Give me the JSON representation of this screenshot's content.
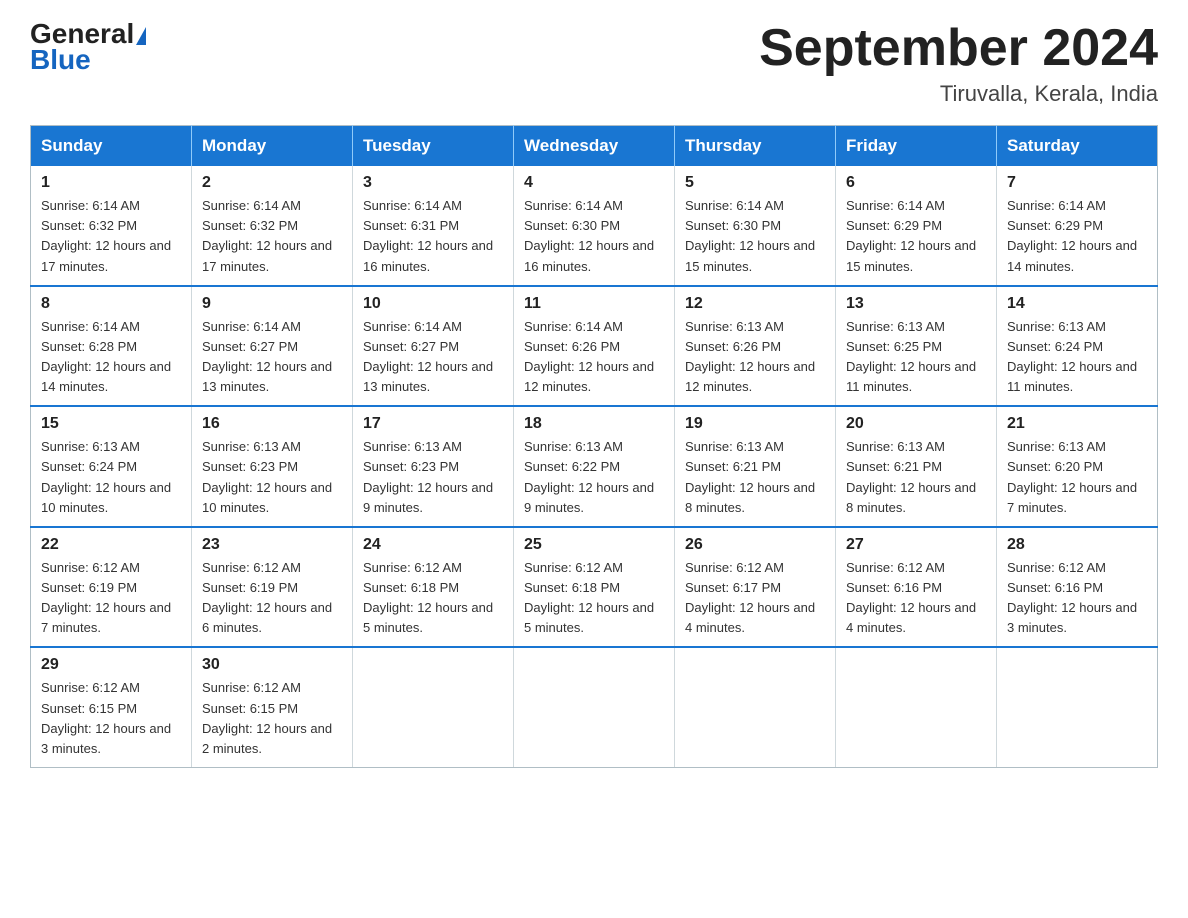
{
  "header": {
    "logo_general": "General",
    "logo_blue": "Blue",
    "title": "September 2024",
    "subtitle": "Tiruvalla, Kerala, India"
  },
  "weekdays": [
    "Sunday",
    "Monday",
    "Tuesday",
    "Wednesday",
    "Thursday",
    "Friday",
    "Saturday"
  ],
  "weeks": [
    [
      {
        "day": "1",
        "sunrise": "6:14 AM",
        "sunset": "6:32 PM",
        "daylight": "12 hours and 17 minutes."
      },
      {
        "day": "2",
        "sunrise": "6:14 AM",
        "sunset": "6:32 PM",
        "daylight": "12 hours and 17 minutes."
      },
      {
        "day": "3",
        "sunrise": "6:14 AM",
        "sunset": "6:31 PM",
        "daylight": "12 hours and 16 minutes."
      },
      {
        "day": "4",
        "sunrise": "6:14 AM",
        "sunset": "6:30 PM",
        "daylight": "12 hours and 16 minutes."
      },
      {
        "day": "5",
        "sunrise": "6:14 AM",
        "sunset": "6:30 PM",
        "daylight": "12 hours and 15 minutes."
      },
      {
        "day": "6",
        "sunrise": "6:14 AM",
        "sunset": "6:29 PM",
        "daylight": "12 hours and 15 minutes."
      },
      {
        "day": "7",
        "sunrise": "6:14 AM",
        "sunset": "6:29 PM",
        "daylight": "12 hours and 14 minutes."
      }
    ],
    [
      {
        "day": "8",
        "sunrise": "6:14 AM",
        "sunset": "6:28 PM",
        "daylight": "12 hours and 14 minutes."
      },
      {
        "day": "9",
        "sunrise": "6:14 AM",
        "sunset": "6:27 PM",
        "daylight": "12 hours and 13 minutes."
      },
      {
        "day": "10",
        "sunrise": "6:14 AM",
        "sunset": "6:27 PM",
        "daylight": "12 hours and 13 minutes."
      },
      {
        "day": "11",
        "sunrise": "6:14 AM",
        "sunset": "6:26 PM",
        "daylight": "12 hours and 12 minutes."
      },
      {
        "day": "12",
        "sunrise": "6:13 AM",
        "sunset": "6:26 PM",
        "daylight": "12 hours and 12 minutes."
      },
      {
        "day": "13",
        "sunrise": "6:13 AM",
        "sunset": "6:25 PM",
        "daylight": "12 hours and 11 minutes."
      },
      {
        "day": "14",
        "sunrise": "6:13 AM",
        "sunset": "6:24 PM",
        "daylight": "12 hours and 11 minutes."
      }
    ],
    [
      {
        "day": "15",
        "sunrise": "6:13 AM",
        "sunset": "6:24 PM",
        "daylight": "12 hours and 10 minutes."
      },
      {
        "day": "16",
        "sunrise": "6:13 AM",
        "sunset": "6:23 PM",
        "daylight": "12 hours and 10 minutes."
      },
      {
        "day": "17",
        "sunrise": "6:13 AM",
        "sunset": "6:23 PM",
        "daylight": "12 hours and 9 minutes."
      },
      {
        "day": "18",
        "sunrise": "6:13 AM",
        "sunset": "6:22 PM",
        "daylight": "12 hours and 9 minutes."
      },
      {
        "day": "19",
        "sunrise": "6:13 AM",
        "sunset": "6:21 PM",
        "daylight": "12 hours and 8 minutes."
      },
      {
        "day": "20",
        "sunrise": "6:13 AM",
        "sunset": "6:21 PM",
        "daylight": "12 hours and 8 minutes."
      },
      {
        "day": "21",
        "sunrise": "6:13 AM",
        "sunset": "6:20 PM",
        "daylight": "12 hours and 7 minutes."
      }
    ],
    [
      {
        "day": "22",
        "sunrise": "6:12 AM",
        "sunset": "6:19 PM",
        "daylight": "12 hours and 7 minutes."
      },
      {
        "day": "23",
        "sunrise": "6:12 AM",
        "sunset": "6:19 PM",
        "daylight": "12 hours and 6 minutes."
      },
      {
        "day": "24",
        "sunrise": "6:12 AM",
        "sunset": "6:18 PM",
        "daylight": "12 hours and 5 minutes."
      },
      {
        "day": "25",
        "sunrise": "6:12 AM",
        "sunset": "6:18 PM",
        "daylight": "12 hours and 5 minutes."
      },
      {
        "day": "26",
        "sunrise": "6:12 AM",
        "sunset": "6:17 PM",
        "daylight": "12 hours and 4 minutes."
      },
      {
        "day": "27",
        "sunrise": "6:12 AM",
        "sunset": "6:16 PM",
        "daylight": "12 hours and 4 minutes."
      },
      {
        "day": "28",
        "sunrise": "6:12 AM",
        "sunset": "6:16 PM",
        "daylight": "12 hours and 3 minutes."
      }
    ],
    [
      {
        "day": "29",
        "sunrise": "6:12 AM",
        "sunset": "6:15 PM",
        "daylight": "12 hours and 3 minutes."
      },
      {
        "day": "30",
        "sunrise": "6:12 AM",
        "sunset": "6:15 PM",
        "daylight": "12 hours and 2 minutes."
      },
      null,
      null,
      null,
      null,
      null
    ]
  ],
  "labels": {
    "sunrise_prefix": "Sunrise: ",
    "sunset_prefix": "Sunset: ",
    "daylight_prefix": "Daylight: "
  }
}
